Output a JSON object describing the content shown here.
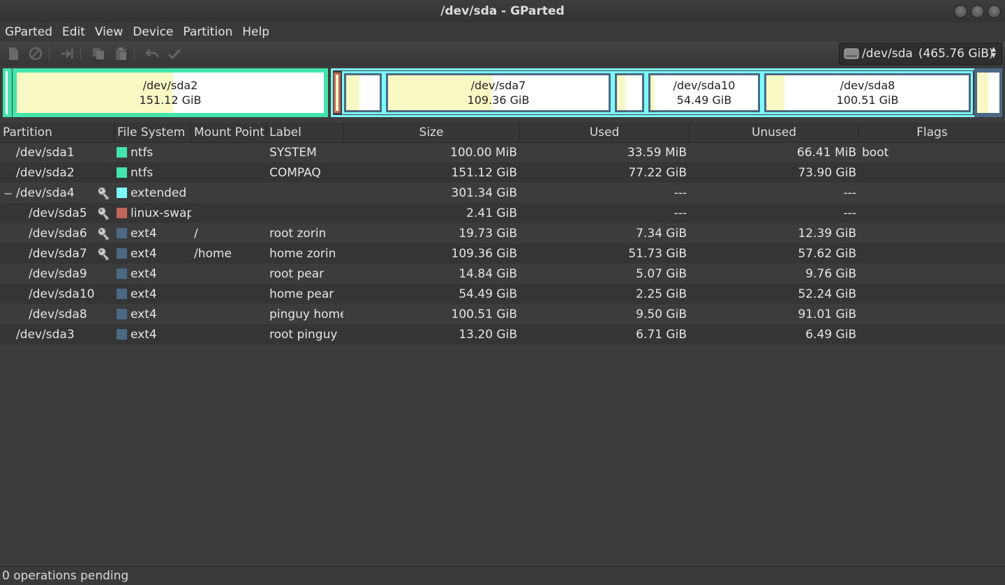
{
  "window": {
    "title": "/dev/sda - GParted"
  },
  "menu": [
    "GParted",
    "Edit",
    "View",
    "Device",
    "Partition",
    "Help"
  ],
  "toolbar": {
    "icons": [
      "new-icon",
      "delete-icon",
      "resize-icon",
      "copy-icon",
      "paste-icon",
      "undo-icon",
      "apply-icon"
    ]
  },
  "device": {
    "name": "/dev/sda",
    "size": "(465.76 GiB)"
  },
  "graphic": {
    "sda2": {
      "name": "/dev/sda2",
      "size": "151.12 GiB"
    },
    "sda7": {
      "name": "/dev/sda7",
      "size": "109.36 GiB"
    },
    "sda10": {
      "name": "/dev/sda10",
      "size": "54.49 GiB"
    },
    "sda8": {
      "name": "/dev/sda8",
      "size": "100.51 GiB"
    }
  },
  "colors": {
    "ntfs": "#42e5ac",
    "extended": "#7dfcfe",
    "linux_swap": "#c1665a",
    "ext4": "#4b6983",
    "used": "#f8f8c4",
    "unused": "#ffffff"
  },
  "table": {
    "headers": [
      "Partition",
      "File System",
      "Mount Point",
      "Label",
      "Size",
      "Used",
      "Unused",
      "Flags"
    ],
    "rows": [
      {
        "partition": "/dev/sda1",
        "fs": "ntfs",
        "mount": "",
        "label": "SYSTEM",
        "size": "100.00 MiB",
        "used": "33.59 MiB",
        "unused": "66.41 MiB",
        "flags": "boot"
      },
      {
        "partition": "/dev/sda2",
        "fs": "ntfs",
        "mount": "",
        "label": "COMPAQ",
        "size": "151.12 GiB",
        "used": "77.22 GiB",
        "unused": "73.90 GiB",
        "flags": ""
      },
      {
        "partition": "/dev/sda4",
        "fs": "extended",
        "mount": "",
        "label": "",
        "size": "301.34 GiB",
        "used": "---",
        "unused": "---",
        "flags": ""
      },
      {
        "partition": "/dev/sda5",
        "fs": "linux-swap",
        "mount": "",
        "label": "",
        "size": "2.41 GiB",
        "used": "---",
        "unused": "---",
        "flags": ""
      },
      {
        "partition": "/dev/sda6",
        "fs": "ext4",
        "mount": "/",
        "label": "root zorin",
        "size": "19.73 GiB",
        "used": "7.34 GiB",
        "unused": "12.39 GiB",
        "flags": ""
      },
      {
        "partition": "/dev/sda7",
        "fs": "ext4",
        "mount": "/home",
        "label": "home zorin",
        "size": "109.36 GiB",
        "used": "51.73 GiB",
        "unused": "57.62 GiB",
        "flags": ""
      },
      {
        "partition": "/dev/sda9",
        "fs": "ext4",
        "mount": "",
        "label": "root pear",
        "size": "14.84 GiB",
        "used": "5.07 GiB",
        "unused": "9.76 GiB",
        "flags": ""
      },
      {
        "partition": "/dev/sda10",
        "fs": "ext4",
        "mount": "",
        "label": "home pear",
        "size": "54.49 GiB",
        "used": "2.25 GiB",
        "unused": "52.24 GiB",
        "flags": ""
      },
      {
        "partition": "/dev/sda8",
        "fs": "ext4",
        "mount": "",
        "label": "pinguy home",
        "size": "100.51 GiB",
        "used": "9.50 GiB",
        "unused": "91.01 GiB",
        "flags": ""
      },
      {
        "partition": "/dev/sda3",
        "fs": "ext4",
        "mount": "",
        "label": "root pinguy",
        "size": "13.20 GiB",
        "used": "6.71 GiB",
        "unused": "6.49 GiB",
        "flags": ""
      }
    ]
  },
  "status": {
    "text": "0 operations pending"
  }
}
